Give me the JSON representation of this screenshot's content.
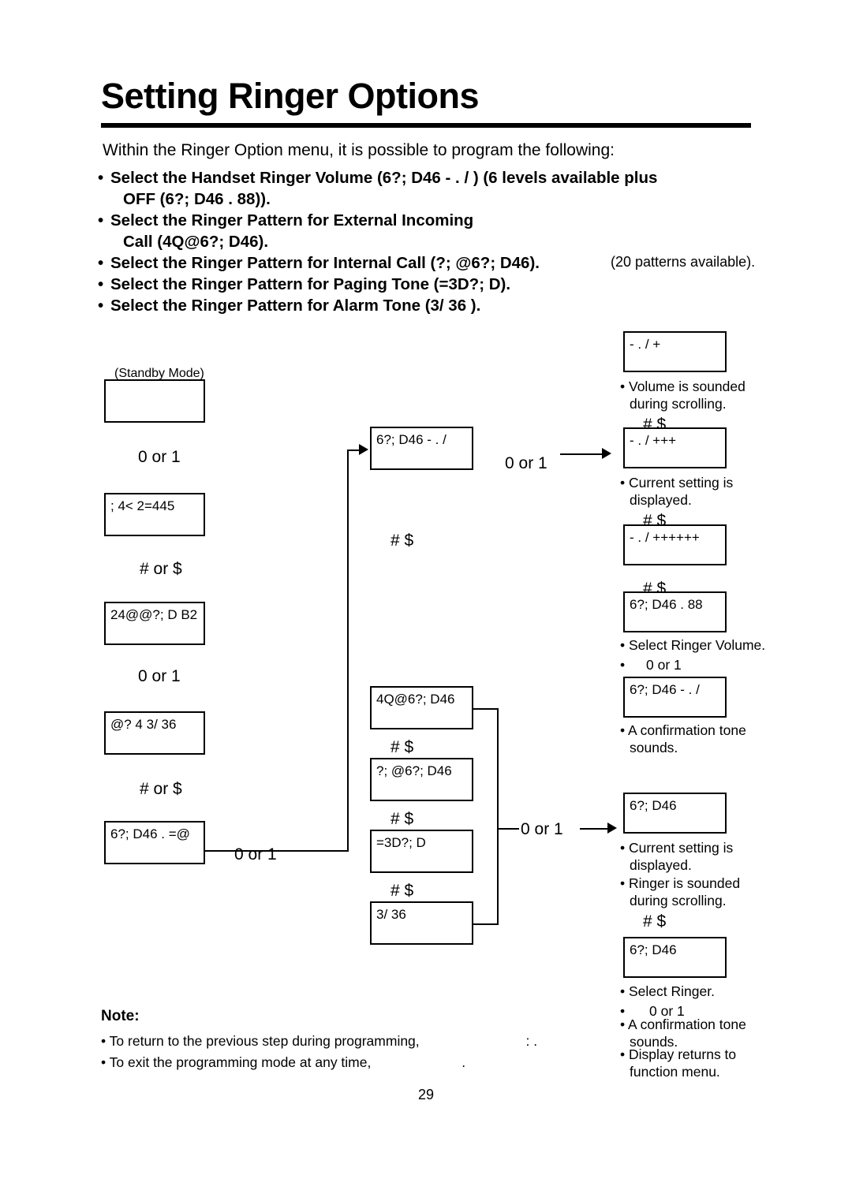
{
  "header": {
    "title": "Setting Ringer Options",
    "intro": "Within the Ringer Option menu, it is possible to program the following:",
    "bullets": [
      {
        "line1": "Select the Handset Ringer Volume (6?; D46 - . / ) (6 levels available plus",
        "line2": "OFF (6?; D46 . 88))."
      },
      {
        "line1": "Select the Ringer Pattern for External Incoming",
        "line2": "Call (4Q@6?; D46)."
      },
      {
        "line1": "Select the Ringer Pattern for Internal Call (?; @6?; D46).",
        "line2": ""
      },
      {
        "line1": "Select the Ringer Pattern for Paging Tone (=3D?; D).",
        "line2": ""
      },
      {
        "line1": "Select the Ringer Pattern for Alarm Tone (3/ 36 ).",
        "line2": ""
      }
    ],
    "patterns_note": "(20 patterns available)."
  },
  "diagram": {
    "standby_label": "(Standby Mode)",
    "screens": {
      "standby": "",
      "s_program": "; 4< 2=445",
      "s_function": "24@@?; D B2",
      "s_alarm": "@? 4 3/ 36",
      "s_ringer_opt": "6?; D46 . =@",
      "s_volume": "6?; D46 - . /",
      "s_external": "4Q@6?; D46",
      "s_internal": "?; @6?; D46",
      "s_paging": "=3D?; D",
      "s_alarm_tone": "3/ 36",
      "v_plus": "- . /     +",
      "v_plus3": "- . /   +++",
      "v_plus6": "- . /   ++++++",
      "v_off": "6?; D46 . 88",
      "v_vol": "6?; D46 - . /",
      "r_ringer1": "6?; D46",
      "r_ringer2": "6?; D46"
    },
    "keys": {
      "nav_updown": "0  or 1",
      "nav_softkeys": "#     $",
      "soft_or": "#  or $"
    },
    "annotations": {
      "vol_sounded": "• Volume is sounded\n  during scrolling.",
      "vol_sounded_l1": "• Volume is sounded",
      "vol_sounded_l2": "during scrolling.",
      "current_setting_l1": "• Current setting is",
      "current_setting_l2": "displayed.",
      "select_volume": "• Select Ringer Volume.",
      "confirm_l1": "• A confirmation tone",
      "confirm_l2": "sounds.",
      "current_setting2_l1": "• Current setting is",
      "current_setting2_l2": "displayed.",
      "ringer_sounded_l1": "• Ringer is sounded",
      "ringer_sounded_l2": "during scrolling.",
      "select_ringer": "• Select Ringer.",
      "confirm2_l1": "• A confirmation tone",
      "confirm2_l2": "sounds.",
      "display_returns_l1": "• Display returns to",
      "display_returns_l2": "function menu.",
      "bullet_dot": "•"
    }
  },
  "footer": {
    "note_heading": "Note:",
    "note1": "• To return to the previous step during programming,",
    "note1_tail": ":  .",
    "note2": "• To exit the programming mode at any time,",
    "note2_tail": ".",
    "page_number": "29"
  }
}
